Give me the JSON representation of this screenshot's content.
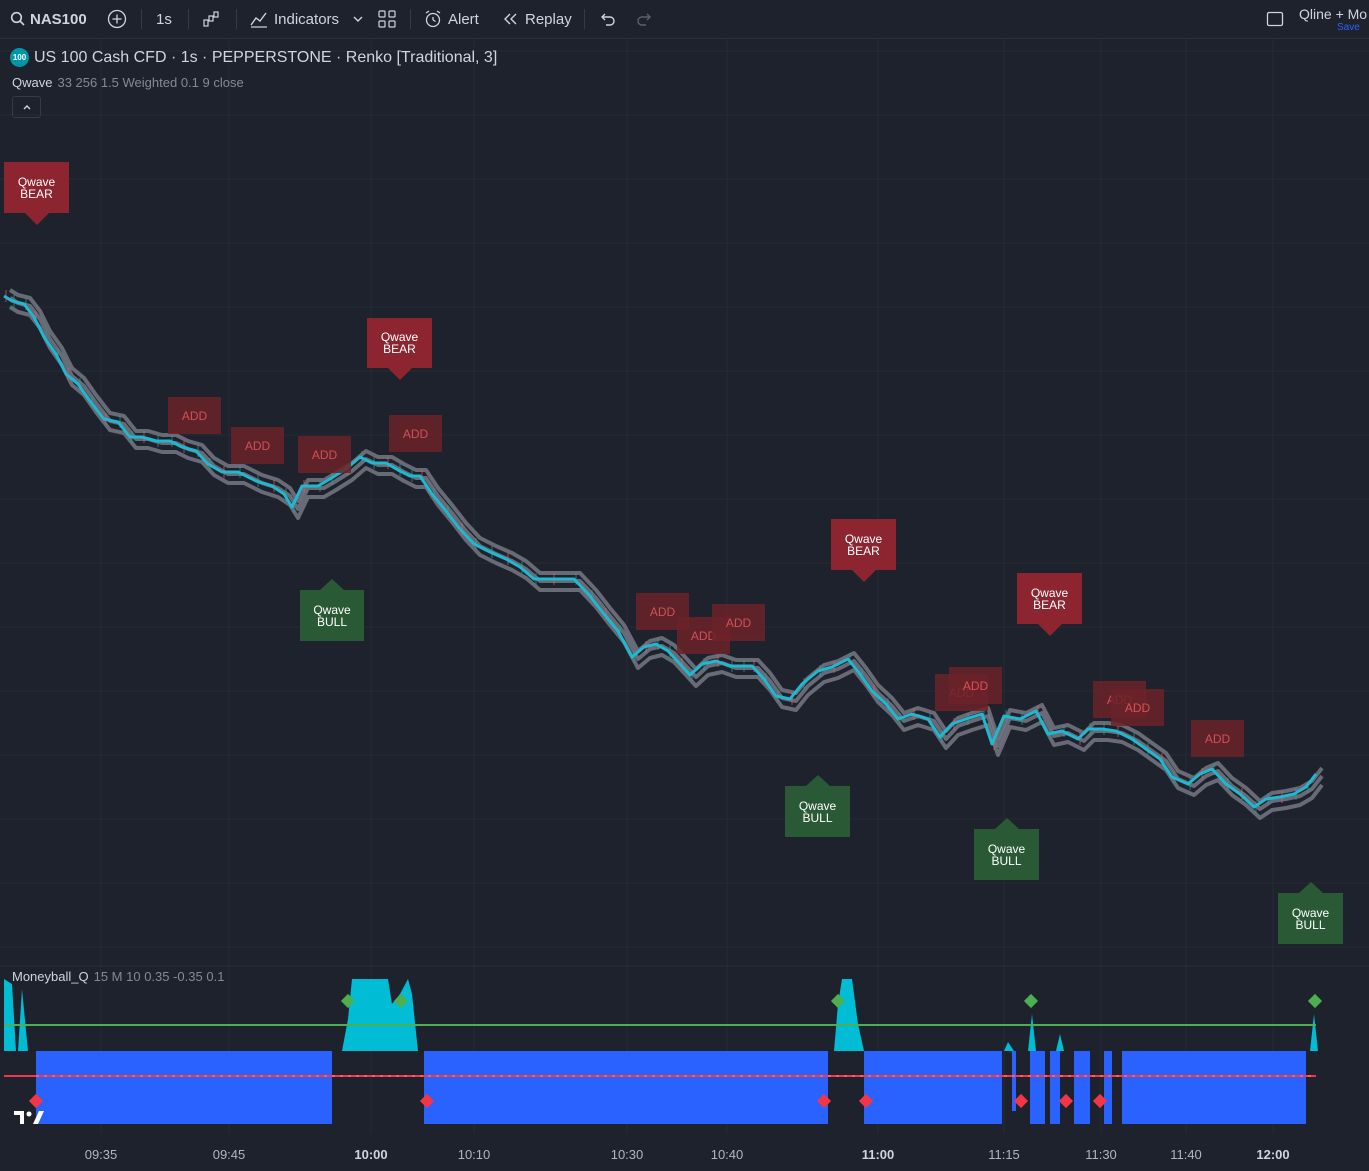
{
  "toolbar": {
    "symbol": "NAS100",
    "interval": "1s",
    "indicators_label": "Indicators",
    "alert_label": "Alert",
    "replay_label": "Replay",
    "layout_name": "Qline + Mo",
    "save_label": "Save"
  },
  "legend": {
    "badge": "100",
    "title": "US 100 Cash CFD · 1s · PEPPERSTONE · Renko [Traditional, 3]",
    "indicator_name": "Qwave",
    "indicator_params": "33 256 1.5 Weighted 0.1 9 close",
    "collapse_icon": "chevron-up-icon"
  },
  "signals": {
    "bear_line1": "Qwave",
    "bear_line2": "BEAR",
    "bull_line1": "Qwave",
    "bull_line2": "BULL",
    "add_label": "ADD"
  },
  "oscillator": {
    "name": "Moneyball_Q",
    "params": "15 M 10 0.35 -0.35 0.1"
  },
  "time_axis": [
    "09:35",
    "09:45",
    "10:00",
    "10:10",
    "10:30",
    "10:40",
    "11:00",
    "11:15",
    "11:30",
    "11:40",
    "12:00"
  ],
  "colors": {
    "background": "#1e222d",
    "price_line": "#1fb8d0",
    "band": "#7a7d87",
    "bear": "#8c2530",
    "bull": "#2a5a35",
    "osc_positive": "#00bcd4",
    "osc_negative": "#2962ff",
    "upper_level": "#4caf50",
    "lower_level": "#f23645"
  }
}
